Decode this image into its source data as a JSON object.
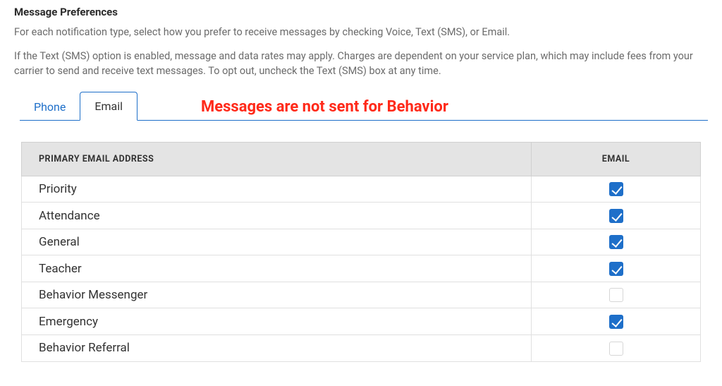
{
  "header": {
    "title": "Message Preferences",
    "line1": "For each notification type, select how you prefer to receive messages by checking Voice, Text (SMS), or Email.",
    "line2": "If the Text (SMS) option is enabled, message and data rates may apply. Charges are dependent on your service plan, which may include fees from your carrier to send and receive text messages. To opt out, uncheck the Text (SMS) box at any time."
  },
  "tabs": {
    "phone": "Phone",
    "email": "Email",
    "active": "email"
  },
  "annotation": "Messages are not sent for Behavior",
  "table": {
    "headers": {
      "primary": "PRIMARY EMAIL ADDRESS",
      "email": "EMAIL"
    },
    "rows": [
      {
        "label": "Priority",
        "checked": true
      },
      {
        "label": "Attendance",
        "checked": true
      },
      {
        "label": "General",
        "checked": true
      },
      {
        "label": "Teacher",
        "checked": true
      },
      {
        "label": "Behavior Messenger",
        "checked": false
      },
      {
        "label": "Emergency",
        "checked": true
      },
      {
        "label": "Behavior Referral",
        "checked": false
      }
    ]
  }
}
